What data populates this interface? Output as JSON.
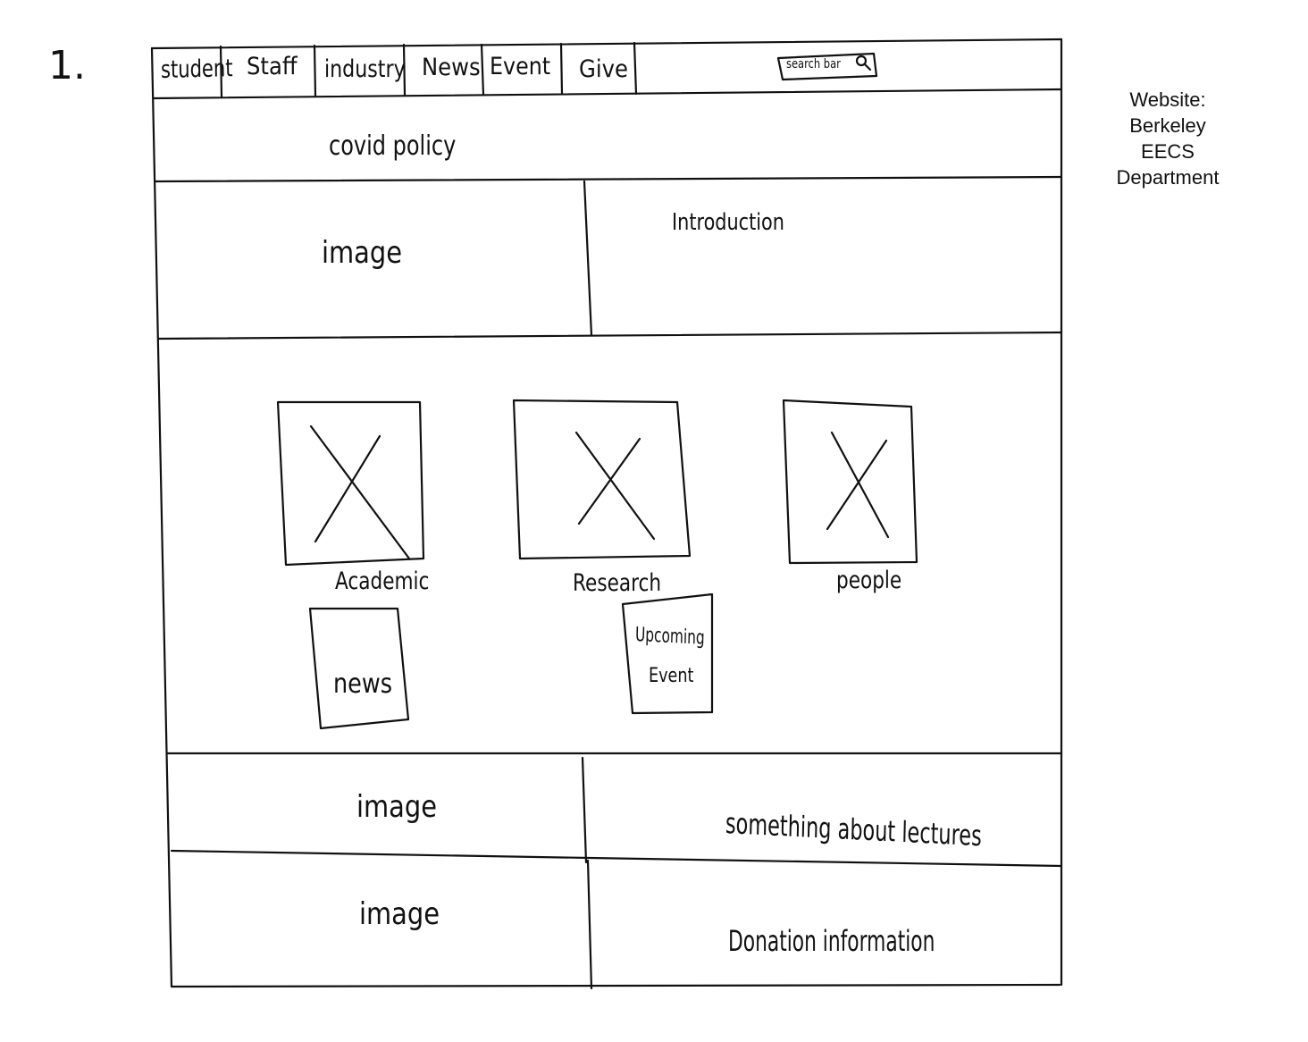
{
  "sketch_number": "1.",
  "nav": {
    "items": [
      "student",
      "Staff",
      "industry",
      "News",
      "Event",
      "Give"
    ],
    "search_label": "search bar"
  },
  "banner": {
    "label": "covid policy"
  },
  "hero": {
    "image_label": "image",
    "intro_label": "Introduction"
  },
  "features": {
    "cards": [
      {
        "label": "Academic"
      },
      {
        "label": "Research"
      },
      {
        "label": "people"
      }
    ],
    "news_label": "news",
    "upcoming_line1": "Upcoming",
    "upcoming_line2": "Event"
  },
  "lectures_row": {
    "image_label": "image",
    "text": "something about lectures"
  },
  "donation_row": {
    "image_label": "image",
    "text": "Donation information"
  },
  "side_note": [
    "Website:",
    "Berkeley",
    "EECS",
    "Department"
  ]
}
